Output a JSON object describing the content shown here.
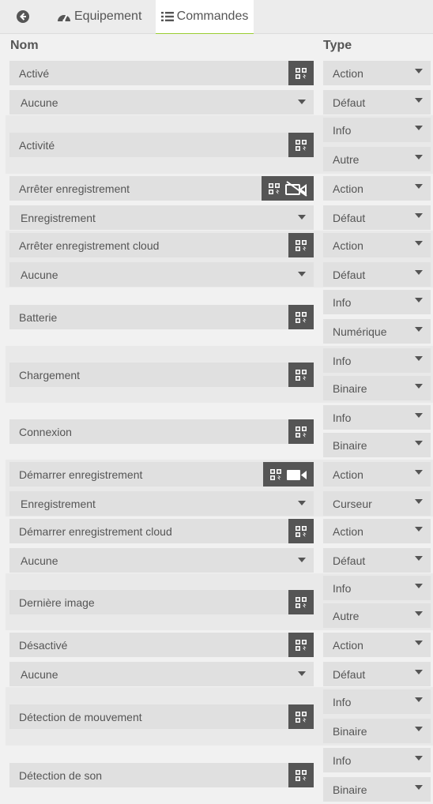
{
  "tabs": {
    "equipement": "Equipement",
    "commandes": "Commandes"
  },
  "header": {
    "nom": "Nom",
    "type": "Type"
  },
  "rows": [
    {
      "name": "Activé",
      "sub": "Aucune",
      "type": "Action",
      "subtype": "Défaut",
      "extra": null
    },
    {
      "name": "Activité",
      "sub": null,
      "type": "Info",
      "subtype": "Autre",
      "extra": null
    },
    {
      "name": "Arrêter enregistrement",
      "sub": "Enregistrement",
      "type": "Action",
      "subtype": "Défaut",
      "extra": "video-off-icon"
    },
    {
      "name": "Arrêter enregistrement cloud",
      "sub": "Aucune",
      "type": "Action",
      "subtype": "Défaut",
      "extra": null
    },
    {
      "name": "Batterie",
      "sub": null,
      "type": "Info",
      "subtype": "Numérique",
      "extra": null
    },
    {
      "name": "Chargement",
      "sub": null,
      "type": "Info",
      "subtype": "Binaire",
      "extra": null
    },
    {
      "name": "Connexion",
      "sub": null,
      "type": "Info",
      "subtype": "Binaire",
      "extra": null
    },
    {
      "name": "Démarrer enregistrement",
      "sub": "Enregistrement",
      "type": "Action",
      "subtype": "Curseur",
      "extra": "video-icon"
    },
    {
      "name": "Démarrer enregistrement cloud",
      "sub": "Aucune",
      "type": "Action",
      "subtype": "Défaut",
      "extra": null
    },
    {
      "name": "Dernière image",
      "sub": null,
      "type": "Info",
      "subtype": "Autre",
      "extra": null
    },
    {
      "name": "Désactivé",
      "sub": "Aucune",
      "type": "Action",
      "subtype": "Défaut",
      "extra": null
    },
    {
      "name": "Détection de mouvement",
      "sub": null,
      "type": "Info",
      "subtype": "Binaire",
      "extra": null
    },
    {
      "name": "Détection de son",
      "sub": null,
      "type": "Info",
      "subtype": "Binaire",
      "extra": null
    }
  ]
}
